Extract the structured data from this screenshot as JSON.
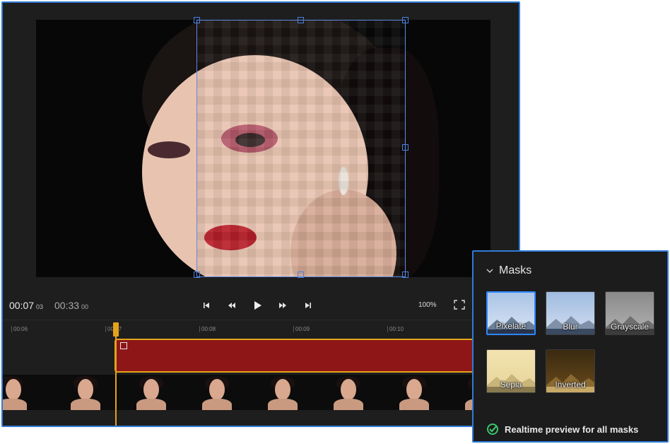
{
  "player": {
    "current_time": "00:07",
    "current_frame": "03",
    "total_time": "00:33",
    "total_frame": "00",
    "zoom": "100%"
  },
  "ruler": {
    "ticks": [
      "00:06",
      "00:07",
      "00:08",
      "00:09",
      "00:10"
    ]
  },
  "masks_panel": {
    "title": "Masks",
    "options": [
      {
        "label": "Pixelate",
        "selected": true
      },
      {
        "label": "Blur",
        "selected": false
      },
      {
        "label": "Grayscale",
        "selected": false
      },
      {
        "label": "Sepia",
        "selected": false
      },
      {
        "label": "Inverted",
        "selected": false
      }
    ],
    "footer": "Realtime preview for all masks"
  },
  "colors": {
    "accent_blue": "#2f7bd8",
    "playhead": "#e4a31a",
    "clip_red": "#8e1616",
    "check_green": "#3bc46a"
  },
  "icons": {
    "skip_back": "skip-back-icon",
    "rewind": "rewind-icon",
    "play": "play-icon",
    "fast_forward": "fast-forward-icon",
    "skip_forward": "skip-forward-icon",
    "fullscreen": "fullscreen-icon",
    "collapse": "chevron-down-icon",
    "check": "check-circle-icon"
  }
}
